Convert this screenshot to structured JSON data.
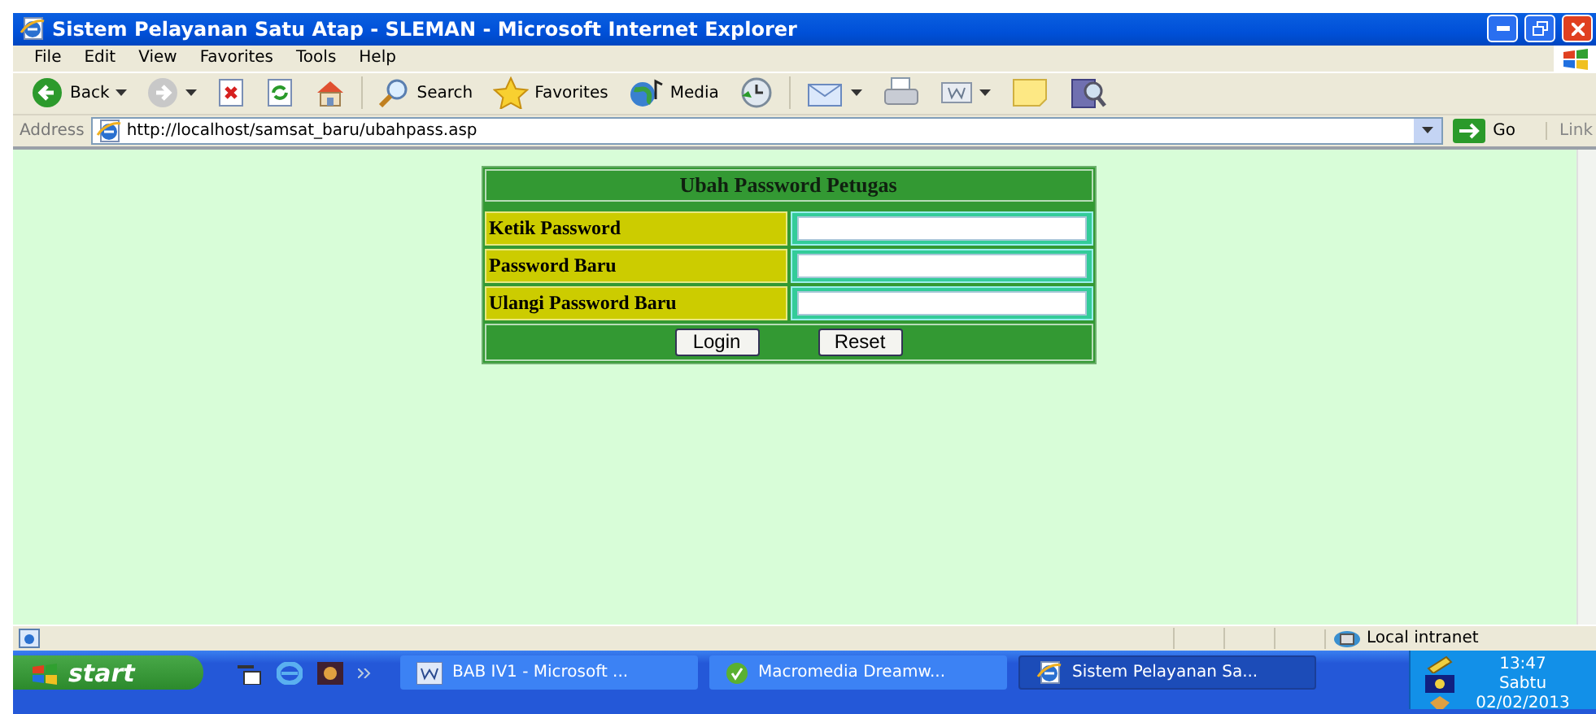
{
  "window": {
    "title": "Sistem Pelayanan Satu Atap - SLEMAN - Microsoft Internet Explorer"
  },
  "menu": [
    "File",
    "Edit",
    "View",
    "Favorites",
    "Tools",
    "Help"
  ],
  "toolbar": [
    {
      "kind": "back",
      "label": "Back",
      "dropdown": true
    },
    {
      "kind": "forward",
      "dropdown": true
    },
    {
      "kind": "stop",
      "dropdown": false
    },
    {
      "kind": "refresh",
      "dropdown": false
    },
    {
      "kind": "home",
      "dropdown": false
    },
    {
      "kind": "search",
      "label": "Search",
      "dropdown": false
    },
    {
      "kind": "favorites",
      "label": "Favorites",
      "dropdown": false
    },
    {
      "kind": "media",
      "label": "Media",
      "dropdown": false
    },
    {
      "kind": "history",
      "dropdown": false
    },
    {
      "kind": "mail",
      "dropdown": true
    },
    {
      "kind": "print",
      "dropdown": false
    },
    {
      "kind": "edit",
      "dropdown": true
    },
    {
      "kind": "note",
      "dropdown": false
    },
    {
      "kind": "research",
      "dropdown": false
    }
  ],
  "address": {
    "label": "Address",
    "url": "http://localhost/samsat_baru/ubahpass.asp",
    "go": "Go",
    "links": "Link"
  },
  "form": {
    "title": "Ubah Password Petugas",
    "fields": [
      {
        "label": "Ketik Password"
      },
      {
        "label": "Password Baru"
      },
      {
        "label": "Ulangi Password Baru"
      }
    ],
    "buttons": [
      "Login",
      "Reset"
    ]
  },
  "status_bar": {
    "zone": "Local intranet"
  },
  "taskbar": {
    "start": "start",
    "tasks": [
      {
        "kind": "word",
        "label": "BAB IV1 - Microsoft ...",
        "selected": false
      },
      {
        "kind": "dreamweaver",
        "label": "Macromedia Dreamw...",
        "selected": false
      },
      {
        "kind": "browser",
        "label": "Sistem Pelayanan Sa...",
        "selected": true
      }
    ],
    "clock": {
      "time": "13:47",
      "day": "Sabtu",
      "date": "02/02/2013"
    }
  }
}
